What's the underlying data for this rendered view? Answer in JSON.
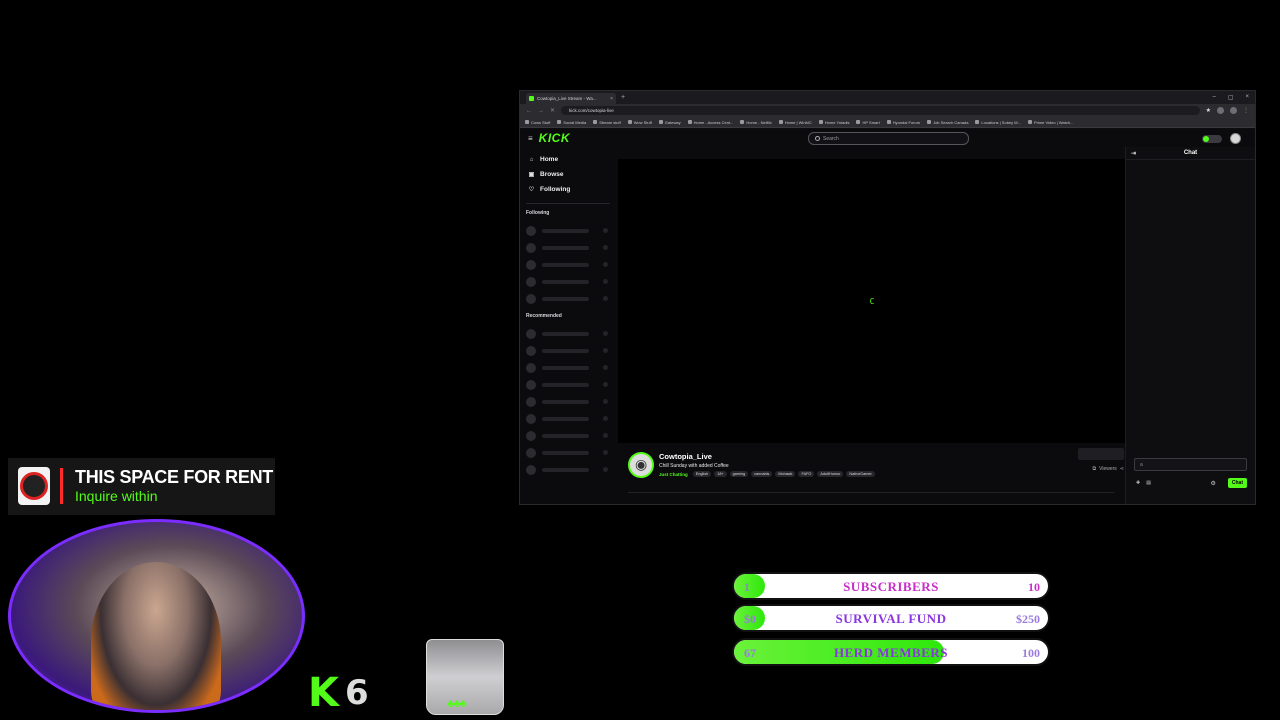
{
  "browser": {
    "tab_title": "Cowtopia_Live Stream - Wa...",
    "tab_close": "×",
    "new_tab": "+",
    "window_controls": [
      "–",
      "▢",
      "×"
    ],
    "url": "kick.com/cowtopia-live",
    "bookmarks": [
      "Cows Stuff",
      "Social Media",
      "Stream stuff",
      "Wow Stuff",
      "Gateway",
      "Home - Access Cent...",
      "Home - Netflix",
      "Home | WinMC",
      "Home Yotadis",
      "HP Smart",
      "Hyundai Forum",
      "Job Search Canada",
      "Locations | Sobey M...",
      "Prime Video | Watch..."
    ]
  },
  "kick": {
    "logo": "KICK",
    "search_placeholder": "Search",
    "nav": [
      {
        "label": "Home",
        "icon": "⌂"
      },
      {
        "label": "Browse",
        "icon": "▣"
      },
      {
        "label": "Following",
        "icon": "♡"
      }
    ],
    "following_heading": "Following",
    "recommended_heading": "Recommended",
    "player_spinner": "C",
    "stream": {
      "name": "Cowtopia_Live",
      "title": "Chill Sunday with added Coffee",
      "category": "Just Chatting",
      "tags": [
        "English",
        "18+",
        "gaming",
        "cannabis",
        "Mohawk",
        "FAFO",
        "AdultHumor",
        "NativeGamer"
      ],
      "viewers_label": "Viewers"
    },
    "chat": {
      "title": "Chat",
      "input_placeholder": "a",
      "send_label": "Chat"
    }
  },
  "overlay": {
    "rent_title": "THIS SPACE FOR RENT",
    "rent_subtitle": "Inquire within",
    "kick_letter": "K",
    "kick_count": "6",
    "tip_coins": "♣♣♣",
    "goals": [
      {
        "lead": "1",
        "label": "SUBSCRIBERS",
        "target": "10",
        "progress": 0.1
      },
      {
        "lead": "$0",
        "label": "SURVIVAL FUND",
        "target": "$250",
        "progress": 0.1
      },
      {
        "lead": "67",
        "label": "HERD MEMBERS",
        "target": "100",
        "progress": 0.67
      }
    ]
  },
  "colors": {
    "kick_green": "#53fc18",
    "goal_purple": "#8a35e0",
    "webcam_ring": "#7b2dff",
    "rent_accent": "#ff2a2a"
  }
}
